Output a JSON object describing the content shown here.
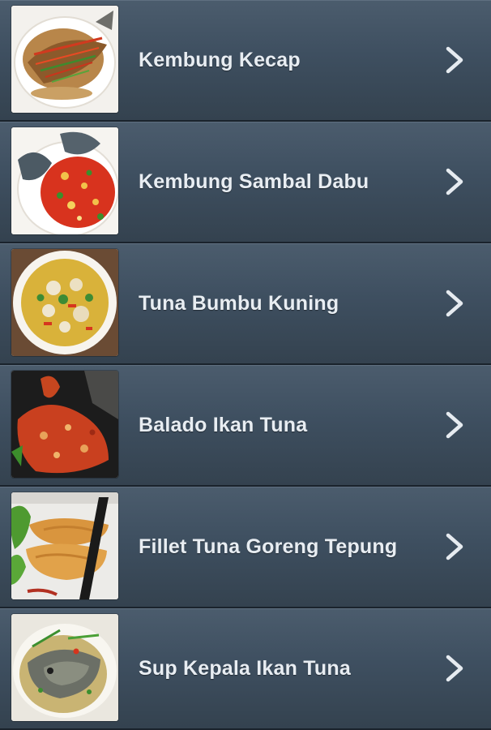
{
  "recipes": [
    {
      "label": "Kembung Kecap",
      "thumbnail_icon": "fish-in-soy-sauce-photo",
      "chevron_icon": "chevron-right-icon"
    },
    {
      "label": "Kembung Sambal Dabu",
      "thumbnail_icon": "fish-with-chili-salsa-photo",
      "chevron_icon": "chevron-right-icon"
    },
    {
      "label": "Tuna Bumbu Kuning",
      "thumbnail_icon": "yellow-spiced-tuna-bowl-photo",
      "chevron_icon": "chevron-right-icon"
    },
    {
      "label": "Balado Ikan Tuna",
      "thumbnail_icon": "tuna-balado-photo",
      "chevron_icon": "chevron-right-icon"
    },
    {
      "label": "Fillet Tuna Goreng Tepung",
      "thumbnail_icon": "fried-battered-tuna-photo",
      "chevron_icon": "chevron-right-icon"
    },
    {
      "label": "Sup Kepala Ikan Tuna",
      "thumbnail_icon": "tuna-head-soup-photo",
      "chevron_icon": "chevron-right-icon"
    }
  ],
  "colors": {
    "row_top": "#4b5c6d",
    "row_bottom": "#34424f",
    "label_text": "#e8edf2",
    "chevron": "#e6ebf0"
  }
}
